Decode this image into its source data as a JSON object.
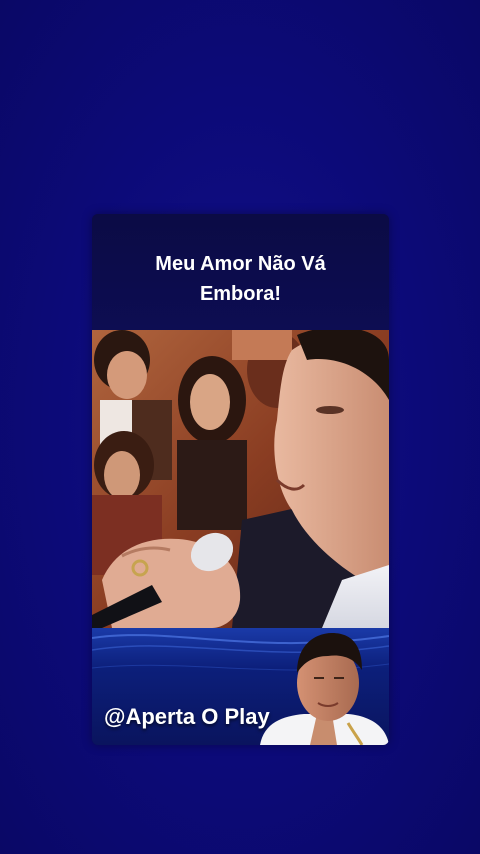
{
  "video": {
    "title": "Meu Amor Não Vá Embora!",
    "channel_handle": "@Aperta O Play"
  },
  "colors": {
    "background": "#0c0a78",
    "card": "#0a0a4e",
    "title_text": "#ffffff"
  },
  "icons": {
    "video_frame": "performer-singing-image",
    "avatar": "singer-portrait-image"
  }
}
